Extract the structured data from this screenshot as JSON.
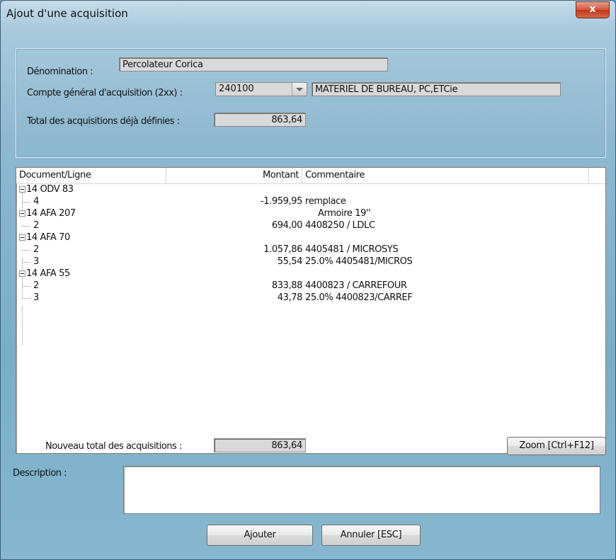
{
  "window": {
    "title": "Ajout d'une acquisition",
    "close_label": "x"
  },
  "form": {
    "denomination_label": "Dénomination :",
    "denomination_value": "Percolateur Corica",
    "compte_label": "Compte général d'acquisition (2xx) :",
    "compte_value": "240100",
    "compte_description": "MATERIEL DE BUREAU, PC,ETCie",
    "total_defined_label": "Total des acquisitions déjà définies :",
    "total_defined_value": "863,64"
  },
  "list": {
    "columns": [
      "Document/Ligne",
      "Montant",
      "Commentaire"
    ],
    "rows": [
      {
        "doc": "14 ODV 83",
        "amount": "",
        "comment": ""
      },
      {
        "doc": "4",
        "amount": "-1.959,95",
        "comment": "remplace"
      },
      {
        "doc": "14 AFA 207",
        "amount": "",
        "comment": "Armoire 19''"
      },
      {
        "doc": "2",
        "amount": "694,00",
        "comment": "4408250 / LDLC"
      },
      {
        "doc": "14 AFA 70",
        "amount": "",
        "comment": ""
      },
      {
        "doc": "2",
        "amount": "1.057,86",
        "comment": "4405481 / MICROSYS"
      },
      {
        "doc": "3",
        "amount": "55,54",
        "comment": "25.0% 4405481/MICROS"
      },
      {
        "doc": "14 AFA 55",
        "amount": "",
        "comment": ""
      },
      {
        "doc": "2",
        "amount": "833,88",
        "comment": "4400823 / CARREFOUR"
      },
      {
        "doc": "3",
        "amount": "43,78",
        "comment": "25.0% 4400823/CARREF"
      }
    ]
  },
  "footer": {
    "new_total_label": "Nouveau total des acquisitions :",
    "new_total_value": "863,64",
    "zoom_label": "Zoom [Ctrl+F12]",
    "description_label": "Description :",
    "description_value": "",
    "add_label": "Ajouter",
    "cancel_label": "Annuler [ESC]"
  }
}
